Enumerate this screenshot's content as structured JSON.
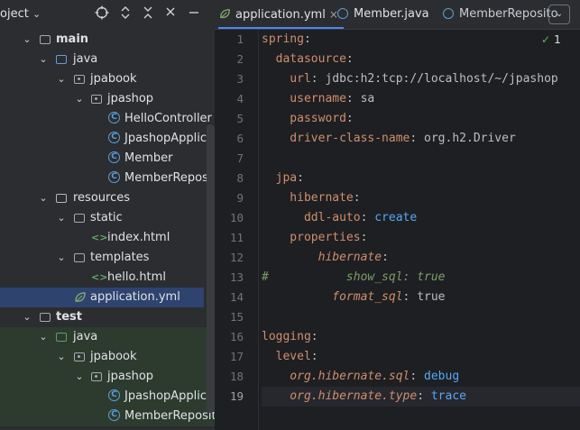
{
  "project_panel": {
    "title": "oject",
    "title_chevron": "⌄",
    "header_icons": [
      "crosshair-icon",
      "expand-collapse-icon",
      "collapse-all-icon",
      "minimize-icon"
    ],
    "tree": [
      {
        "label": "main",
        "type": "folder",
        "expanded": true
      },
      {
        "label": "java",
        "type": "source-folder",
        "expanded": true
      },
      {
        "label": "jpabook",
        "type": "package",
        "expanded": true
      },
      {
        "label": "jpashop",
        "type": "package",
        "expanded": true
      },
      {
        "label": "HelloController",
        "type": "class"
      },
      {
        "label": "JpashopApplicat",
        "type": "spring-class"
      },
      {
        "label": "Member",
        "type": "class"
      },
      {
        "label": "MemberReposit",
        "type": "class"
      },
      {
        "label": "resources",
        "type": "resource-folder",
        "expanded": true
      },
      {
        "label": "static",
        "type": "folder",
        "expanded": true
      },
      {
        "label": "index.html",
        "type": "html"
      },
      {
        "label": "templates",
        "type": "folder",
        "expanded": true
      },
      {
        "label": "hello.html",
        "type": "html"
      },
      {
        "label": "application.yml",
        "type": "yml",
        "selected": true
      },
      {
        "label": "test",
        "type": "folder",
        "expanded": true
      },
      {
        "label": "java",
        "type": "test-folder",
        "expanded": true
      },
      {
        "label": "jpabook",
        "type": "package",
        "expanded": true
      },
      {
        "label": "jpashop",
        "type": "package",
        "expanded": true
      },
      {
        "label": "JpashopApplicat",
        "type": "class"
      },
      {
        "label": "MemberReposit",
        "type": "class"
      }
    ]
  },
  "editor": {
    "tabs": [
      {
        "label": "application.yml",
        "active": true,
        "close": "×"
      },
      {
        "label": "Member.java",
        "active": false
      },
      {
        "label": "MemberReposito",
        "active": false
      }
    ],
    "tab_menu_icon": "⌄",
    "inspection": {
      "icon": "check-icon",
      "count": "1"
    },
    "line_numbers": [
      "1",
      "2",
      "3",
      "4",
      "5",
      "6",
      "7",
      "8",
      "9",
      "10",
      "11",
      "12",
      "13",
      "14",
      "15",
      "16",
      "17",
      "18",
      "19"
    ],
    "current_line": 19,
    "code_lines": [
      [
        {
          "t": "spring",
          "c": "k"
        },
        {
          "t": ":",
          "c": "v"
        }
      ],
      [
        {
          "t": "  datasource",
          "c": "k"
        },
        {
          "t": ":",
          "c": "v"
        }
      ],
      [
        {
          "t": "    url",
          "c": "k"
        },
        {
          "t": ": jdbc:h2:tcp://localhost/~/jpashop",
          "c": "v"
        }
      ],
      [
        {
          "t": "    username",
          "c": "k"
        },
        {
          "t": ": sa",
          "c": "v"
        }
      ],
      [
        {
          "t": "    password",
          "c": "k"
        },
        {
          "t": ":",
          "c": "v"
        }
      ],
      [
        {
          "t": "    driver-class-name",
          "c": "k"
        },
        {
          "t": ": org.h2.Driver",
          "c": "v"
        }
      ],
      [],
      [
        {
          "t": "  jpa",
          "c": "k"
        },
        {
          "t": ":",
          "c": "v"
        }
      ],
      [
        {
          "t": "    hibernate",
          "c": "k"
        },
        {
          "t": ":",
          "c": "v"
        }
      ],
      [
        {
          "t": "      ddl-auto",
          "c": "k"
        },
        {
          "t": ": ",
          "c": "v"
        },
        {
          "t": "create",
          "c": "vb"
        }
      ],
      [
        {
          "t": "    properties",
          "c": "k"
        },
        {
          "t": ":",
          "c": "v"
        }
      ],
      [
        {
          "t": "        hibernate",
          "c": "ki"
        },
        {
          "t": ":",
          "c": "v"
        }
      ],
      [
        {
          "t": "#",
          "c": "hash"
        },
        {
          "t": "           show_sql: true",
          "c": "cm"
        }
      ],
      [
        {
          "t": "          format_sql",
          "c": "ki"
        },
        {
          "t": ": true",
          "c": "v"
        }
      ],
      [],
      [
        {
          "t": "logging",
          "c": "k"
        },
        {
          "t": ":",
          "c": "v"
        }
      ],
      [
        {
          "t": "  level",
          "c": "k"
        },
        {
          "t": ":",
          "c": "v"
        }
      ],
      [
        {
          "t": "    org.hibernate.sql",
          "c": "ki"
        },
        {
          "t": ": ",
          "c": "v"
        },
        {
          "t": "debug",
          "c": "vb"
        }
      ],
      [
        {
          "t": "    org.hibernate.type",
          "c": "ki"
        },
        {
          "t": ": ",
          "c": "v"
        },
        {
          "t": "trace",
          "c": "vb"
        }
      ]
    ]
  }
}
